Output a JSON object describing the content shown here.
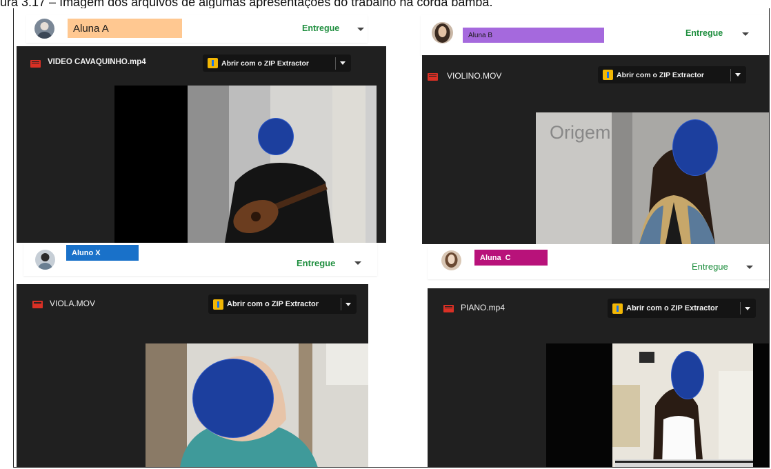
{
  "caption": "ura 3.17 – Imagem dos arquivos de algumas apresentações do trabalho na corda bamba.",
  "submissions": [
    {
      "student": "Aluna A",
      "tag_color": "#ffc891",
      "status": "Entregue",
      "file": "VIDEO CAVAQUINHO.mp4",
      "open_label": "Abrir com o ZIP Extractor"
    },
    {
      "student": "Aluna B",
      "tag_color": "#a569dd",
      "status": "Entregue",
      "file": "VIOLINO.MOV",
      "open_label": "Abrir com o ZIP Extractor",
      "video_overlay_text": "Origem"
    },
    {
      "student": "Aluno X",
      "tag_color": "#1971c9",
      "status": "Entregue",
      "file": "VIOLA.MOV",
      "open_label": "Abrir com o ZIP Extractor"
    },
    {
      "student": "Aluna  C",
      "tag_color": "#b8127a",
      "status": "Entregue",
      "file": "PIANO.mp4",
      "open_label": "Abrir com o ZIP Extractor"
    }
  ],
  "colors": {
    "status_green": "#1e8e3e",
    "viewer_bg": "#202020",
    "face_blur": "#1c3f9e",
    "file_icon": "#d93025"
  },
  "icons": [
    "video-file-icon",
    "zip-extractor-icon",
    "chevron-down-icon",
    "avatar"
  ]
}
